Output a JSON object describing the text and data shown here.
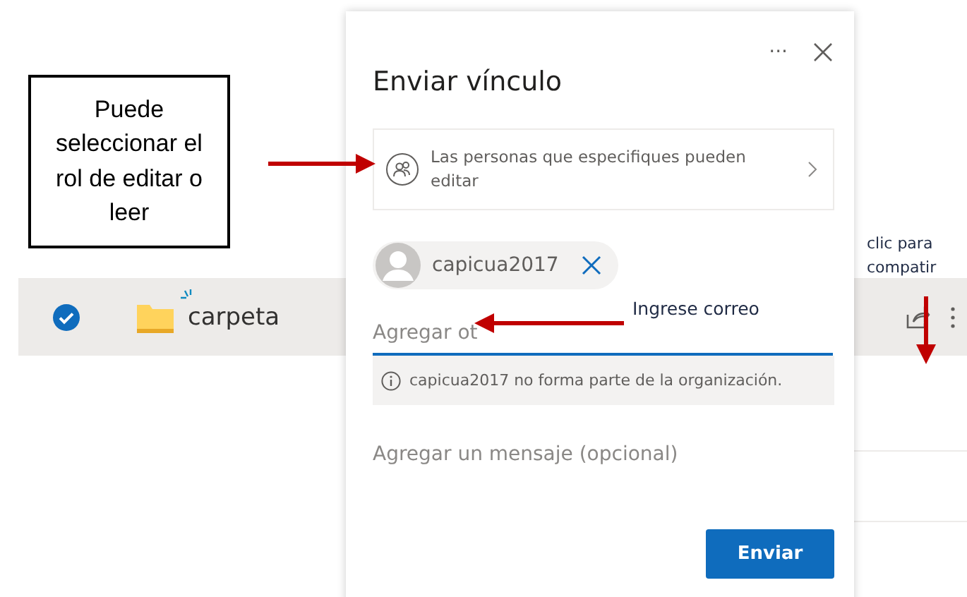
{
  "file_row": {
    "selected": true,
    "name": "carpeta"
  },
  "dialog": {
    "title": "Enviar vínculo",
    "more": "···",
    "permission": "Las personas que especifiques pueden editar",
    "recipients": [
      {
        "name": "capicua2017"
      }
    ],
    "add_field": {
      "placeholder": "Agregar ot"
    },
    "warning": "capicua2017 no forma parte de la organización.",
    "message_field": {
      "placeholder": "Agregar un mensaje (opcional)"
    },
    "send_button": "Enviar"
  },
  "annotations": [
    {
      "kind": "callout",
      "text": "Puede seleccionar el rol de editar o leer"
    },
    {
      "kind": "label",
      "text": "Ingrese correo"
    },
    {
      "kind": "label",
      "text": "clic para compatir"
    }
  ]
}
